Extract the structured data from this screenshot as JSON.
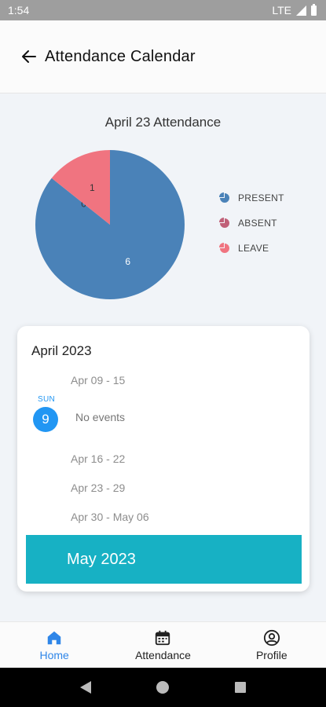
{
  "status_bar": {
    "time": "1:54",
    "network": "LTE"
  },
  "app_bar": {
    "title": "Attendance Calendar"
  },
  "chart_data": {
    "type": "pie",
    "title": "April 23 Attendance",
    "slices": [
      {
        "label": "PRESENT",
        "value": 6,
        "color": "#4a82b8"
      },
      {
        "label": "ABSENT",
        "value": 0,
        "color": "#c06078"
      },
      {
        "label": "LEAVE",
        "value": 1,
        "color": "#f07480"
      }
    ]
  },
  "calendar": {
    "month_title": "April 2023",
    "weeks": [
      "Apr 09 - 15",
      "Apr 16 - 22",
      "Apr 23 - 29",
      "Apr 30 - May 06"
    ],
    "selected_day": {
      "abbr": "SUN",
      "number": "9",
      "events_text": "No events"
    },
    "next_month": "May 2023"
  },
  "bottom_nav": {
    "items": [
      {
        "label": "Home"
      },
      {
        "label": "Attendance"
      },
      {
        "label": "Profile"
      }
    ]
  },
  "colors": {
    "accent": "#2196f3",
    "month_band": "#17b1c4",
    "nav_active": "#2f86e8"
  }
}
